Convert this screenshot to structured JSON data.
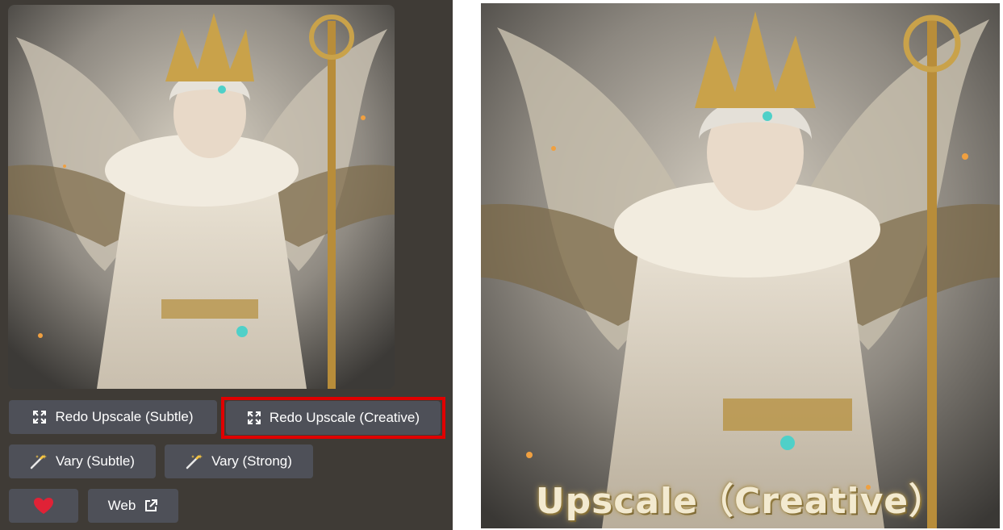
{
  "buttons": {
    "redo_upscale_subtle": "Redo Upscale (Subtle)",
    "redo_upscale_creative": "Redo Upscale (Creative)",
    "vary_subtle": "Vary (Subtle)",
    "vary_strong": "Vary (Strong)",
    "web": "Web"
  },
  "icons": {
    "upscale": "expand-corners-icon",
    "vary": "magic-wand-sparkle-icon",
    "favorite": "heart-icon",
    "external_link": "external-link-icon"
  },
  "caption": "Upscale（Creative）",
  "colors": {
    "panel_bg": "#3f3b36",
    "button_bg": "#4e5058",
    "highlight_border": "#e00000",
    "heart": "#e02236",
    "caption_text": "#f3ead0"
  }
}
